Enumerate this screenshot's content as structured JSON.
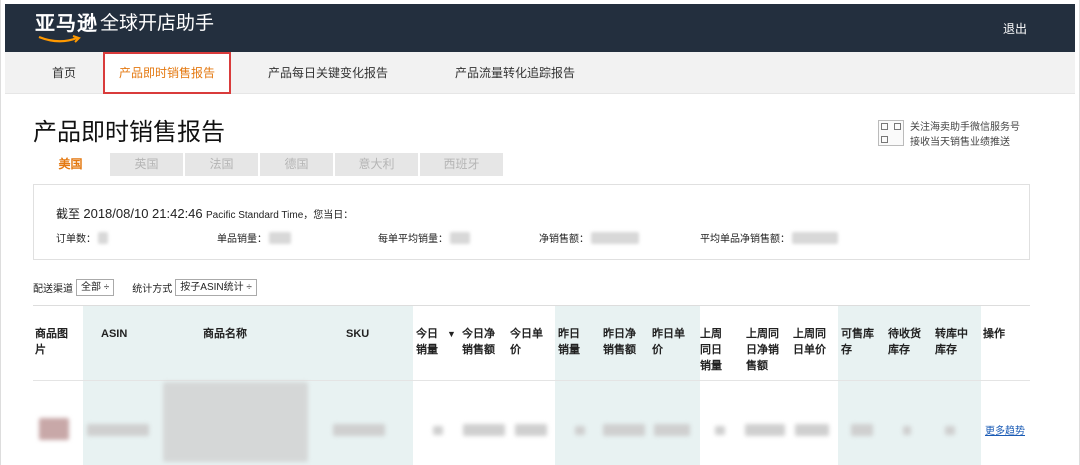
{
  "header": {
    "brand": "亚马逊",
    "product": "全球开店助手",
    "logout_label": "退出"
  },
  "nav": {
    "items": [
      {
        "label": "首页"
      },
      {
        "label": "产品即时销售报告"
      },
      {
        "label": "产品每日关键变化报告"
      },
      {
        "label": "产品流量转化追踪报告"
      }
    ],
    "active_index": 1
  },
  "page": {
    "title": "产品即时销售报告"
  },
  "promo": {
    "line1": "关注海卖助手微信服务号",
    "line2": "接收当天销售业绩推送"
  },
  "country_tabs": [
    {
      "label": "美国"
    },
    {
      "label": "英国"
    },
    {
      "label": "法国"
    },
    {
      "label": "德国"
    },
    {
      "label": "意大利"
    },
    {
      "label": "西班牙"
    }
  ],
  "summary": {
    "prefix": "截至",
    "timestamp": "2018/08/10 21:42:46",
    "timezone": "Pacific Standard Time",
    "suffix": "，您当日：",
    "metrics": [
      {
        "label": "订单数："
      },
      {
        "label": "单品销量："
      },
      {
        "label": "每单平均销量："
      },
      {
        "label": "净销售额："
      },
      {
        "label": "平均单品净销售额："
      }
    ]
  },
  "filters": {
    "channel_label": "配送渠道",
    "channel_value": "全部 ÷",
    "method_label": "统计方式",
    "method_value": "按子ASIN统计 ÷"
  },
  "table": {
    "headers": [
      {
        "lines": [
          "商品图",
          "片"
        ]
      },
      {
        "lines": [
          "ASIN"
        ]
      },
      {
        "lines": [
          "商品名称"
        ]
      },
      {
        "lines": [
          "SKU"
        ]
      },
      {
        "lines": [
          "今日",
          "销量"
        ]
      },
      {
        "lines": [
          "今日净",
          "销售额"
        ]
      },
      {
        "lines": [
          "今日单",
          "价"
        ]
      },
      {
        "lines": [
          "昨日",
          "销量"
        ]
      },
      {
        "lines": [
          "昨日净",
          "销售额"
        ]
      },
      {
        "lines": [
          "昨日单",
          "价"
        ]
      },
      {
        "lines": [
          "上周",
          "同日",
          "销量"
        ]
      },
      {
        "lines": [
          "上周同",
          "日净销",
          "售额"
        ]
      },
      {
        "lines": [
          "上周同",
          "日单价"
        ]
      },
      {
        "lines": [
          "可售库",
          "存"
        ]
      },
      {
        "lines": [
          "待收货",
          "库存"
        ]
      },
      {
        "lines": [
          "转库中",
          "库存"
        ]
      },
      {
        "lines": [
          "操作"
        ]
      }
    ],
    "sort_indicator": "▼",
    "action_link": "更多趋势"
  },
  "colors": {
    "topbar": "#232f3e",
    "accent": "#e47911",
    "highlight_border": "#d93b3b",
    "link": "#1a5bb5"
  }
}
